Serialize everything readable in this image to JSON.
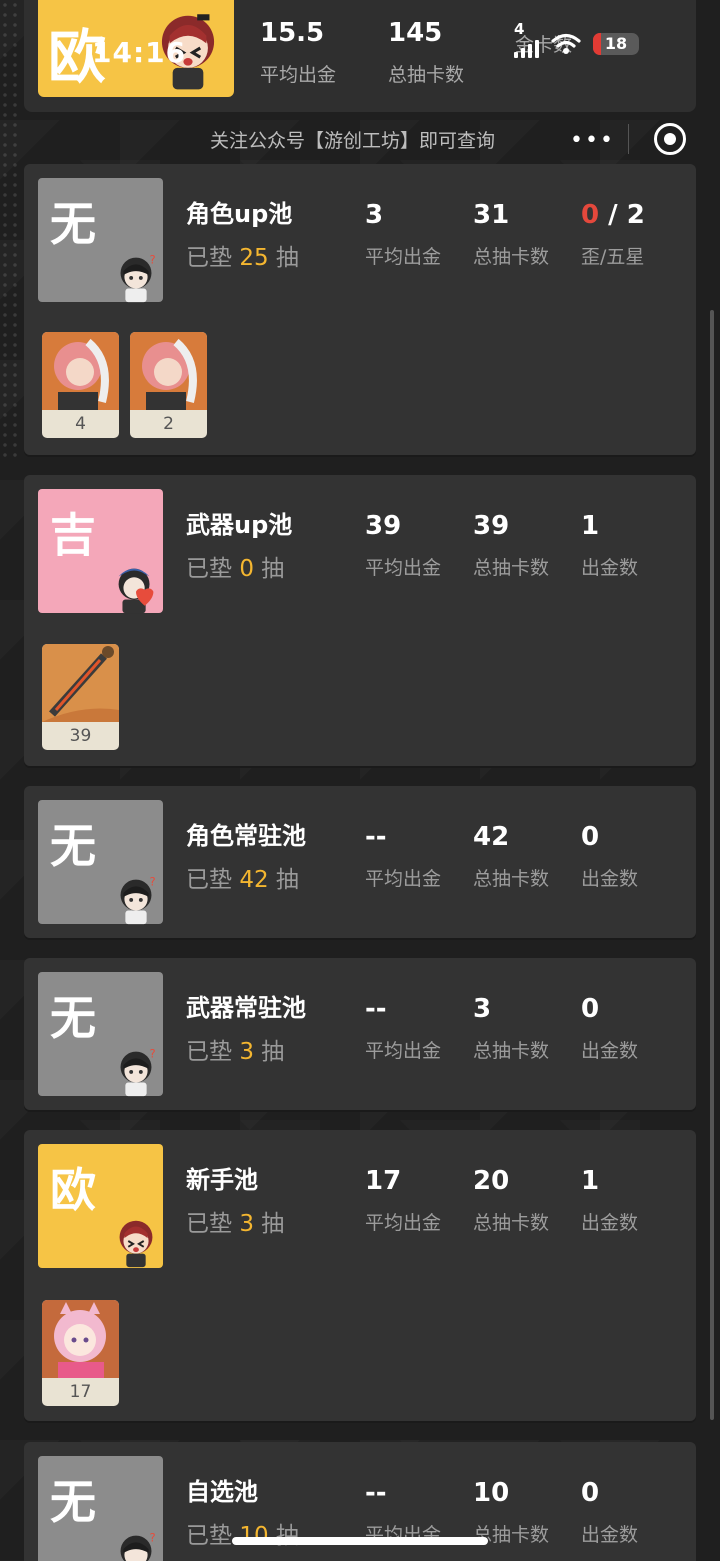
{
  "status_bar": {
    "time": "14:16",
    "network": "4",
    "battery": "18"
  },
  "summary": {
    "badge_char": "欧",
    "stats": [
      {
        "value": "15.5",
        "label": "平均出金"
      },
      {
        "value": "145",
        "label": "总抽卡数"
      },
      {
        "value": "",
        "label": "金卡数"
      }
    ]
  },
  "notice": "关注公众号【游创工坊】即可查询",
  "capsule": {
    "more": "•••"
  },
  "cards": [
    {
      "grade": "无",
      "grade_color": "#8c8c8c",
      "name": "角色up池",
      "pity_prefix": "已垫",
      "pity": "25",
      "pity_suffix": "抽",
      "stats": [
        {
          "value": "3",
          "label": "平均出金"
        },
        {
          "value": "31",
          "label": "总抽卡数"
        },
        {
          "value_red": "0",
          "value_rest": " / 2",
          "label": "歪/五星"
        }
      ],
      "thumbs": [
        "4",
        "2"
      ]
    },
    {
      "grade": "吉",
      "grade_color": "#f4a7b9",
      "name": "武器up池",
      "pity_prefix": "已垫",
      "pity": "0",
      "pity_suffix": "抽",
      "stats": [
        {
          "value": "39",
          "label": "平均出金"
        },
        {
          "value": "39",
          "label": "总抽卡数"
        },
        {
          "value": "1",
          "label": "出金数"
        }
      ],
      "thumbs": [
        "39"
      ]
    },
    {
      "grade": "无",
      "grade_color": "#8c8c8c",
      "name": "角色常驻池",
      "pity_prefix": "已垫",
      "pity": "42",
      "pity_suffix": "抽",
      "stats": [
        {
          "value": "--",
          "label": "平均出金"
        },
        {
          "value": "42",
          "label": "总抽卡数"
        },
        {
          "value": "0",
          "label": "出金数"
        }
      ],
      "thumbs": []
    },
    {
      "grade": "无",
      "grade_color": "#8c8c8c",
      "name": "武器常驻池",
      "pity_prefix": "已垫",
      "pity": "3",
      "pity_suffix": "抽",
      "stats": [
        {
          "value": "--",
          "label": "平均出金"
        },
        {
          "value": "3",
          "label": "总抽卡数"
        },
        {
          "value": "0",
          "label": "出金数"
        }
      ],
      "thumbs": []
    },
    {
      "grade": "欧",
      "grade_color": "#f6c445",
      "name": "新手池",
      "pity_prefix": "已垫",
      "pity": "3",
      "pity_suffix": "抽",
      "stats": [
        {
          "value": "17",
          "label": "平均出金"
        },
        {
          "value": "20",
          "label": "总抽卡数"
        },
        {
          "value": "1",
          "label": "出金数"
        }
      ],
      "thumbs": [
        "17"
      ]
    },
    {
      "grade": "无",
      "grade_color": "#8c8c8c",
      "name": "自选池",
      "pity_prefix": "已垫",
      "pity": "10",
      "pity_suffix": "抽",
      "stats": [
        {
          "value": "--",
          "label": "平均出金"
        },
        {
          "value": "10",
          "label": "总抽卡数"
        },
        {
          "value": "0",
          "label": "出金数"
        }
      ],
      "thumbs": []
    }
  ]
}
